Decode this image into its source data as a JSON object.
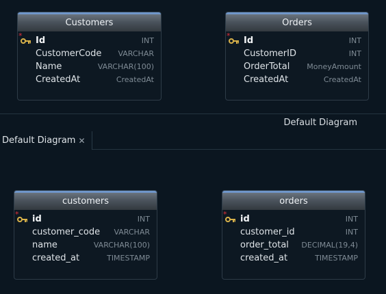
{
  "top_diagram": {
    "title": "Default Diagram",
    "tables": [
      {
        "name": "Customers",
        "columns": [
          {
            "name": "Id",
            "type": "INT",
            "pk": true
          },
          {
            "name": "CustomerCode",
            "type": "VARCHAR"
          },
          {
            "name": "Name",
            "type": "VARCHAR(100)"
          },
          {
            "name": "CreatedAt",
            "type": "CreatedAt"
          }
        ]
      },
      {
        "name": "Orders",
        "columns": [
          {
            "name": "Id",
            "type": "INT",
            "pk": true
          },
          {
            "name": "CustomerID",
            "type": "INT"
          },
          {
            "name": "OrderTotal",
            "type": "MoneyAmount"
          },
          {
            "name": "CreatedAt",
            "type": "CreatedAt"
          }
        ]
      }
    ]
  },
  "tab": {
    "label": "Default Diagram",
    "close_glyph": "✕"
  },
  "bottom_diagram": {
    "tables": [
      {
        "name": "customers",
        "columns": [
          {
            "name": "id",
            "type": "INT",
            "pk": true
          },
          {
            "name": "customer_code",
            "type": "VARCHAR"
          },
          {
            "name": "name",
            "type": "VARCHAR(100)"
          },
          {
            "name": "created_at",
            "type": "TIMESTAMP"
          }
        ]
      },
      {
        "name": "orders",
        "columns": [
          {
            "name": "id",
            "type": "INT",
            "pk": true
          },
          {
            "name": "customer_id",
            "type": "INT"
          },
          {
            "name": "order_total",
            "type": "DECIMAL(19,4)"
          },
          {
            "name": "created_at",
            "type": "TIMESTAMP"
          }
        ]
      }
    ]
  },
  "colors": {
    "header_accent": "#6f96c9",
    "pk_marker": "#e0303a",
    "key_icon": "#d9b24a"
  },
  "icons": {
    "primary_key": "key-icon",
    "pk_marker": "asterisk-icon",
    "close": "close-icon"
  }
}
